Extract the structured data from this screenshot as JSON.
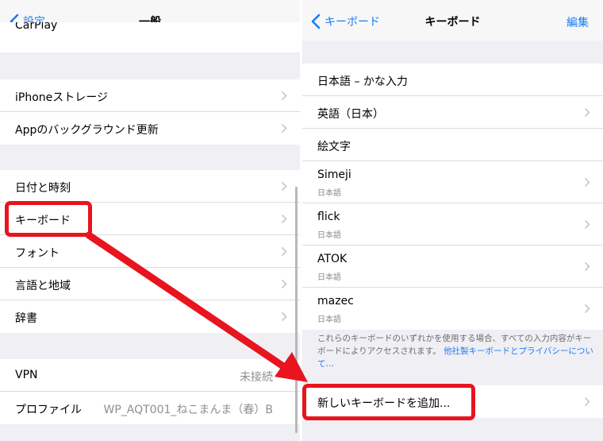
{
  "left": {
    "back_label": "設定",
    "title": "一般",
    "partial_row": "CarPlay",
    "group2": [
      "iPhoneストレージ",
      "Appのバックグラウンド更新"
    ],
    "group3": [
      "日付と時刻",
      "キーボード",
      "フォント",
      "言語と地域",
      "辞書"
    ],
    "vpn_label": "VPN",
    "vpn_status": "未接続",
    "profile_label": "プロファイル",
    "profile_value": "WP_AQT001_ねこまんま（春）B"
  },
  "right": {
    "back_label": "キーボード",
    "title": "キーボード",
    "edit_label": "編集",
    "keyboards": [
      {
        "name": "日本語 – かな入力",
        "sub": ""
      },
      {
        "name": "英語（日本）",
        "sub": ""
      },
      {
        "name": "絵文字",
        "sub": ""
      },
      {
        "name": "Simeji",
        "sub": "日本語"
      },
      {
        "name": "flick",
        "sub": "日本語"
      },
      {
        "name": "ATOK",
        "sub": "日本語"
      },
      {
        "name": "mazec",
        "sub": "日本語"
      }
    ],
    "footnote_text": "これらのキーボードのいずれかを使用する場合、すべての入力内容がキーボードによりアクセスされます。",
    "footnote_link": "他社製キーボードとプライバシーについて…",
    "add_keyboard": "新しいキーボードを追加..."
  },
  "colors": {
    "accent": "#1a7cf5",
    "highlight": "#e8141e",
    "background": "#efeff4"
  },
  "icons": [
    "chevron-left-icon",
    "chevron-right-icon"
  ]
}
